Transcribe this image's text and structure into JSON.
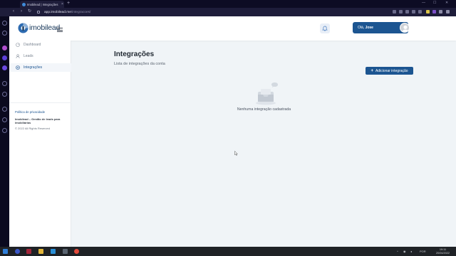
{
  "browser": {
    "tab_title": "Imobilead | Integrações",
    "tab_close": "×",
    "new_tab": "+",
    "url_host": "app.imobilead.me",
    "url_path": "/integracoes/",
    "window_controls": [
      "—",
      "☐",
      "✕"
    ],
    "nav_icons": [
      "back-icon",
      "forward-icon",
      "reload-icon"
    ]
  },
  "header": {
    "logo_text": "imobilead",
    "greeting_prefix": "Olá,",
    "user_name": "Jose",
    "icons": [
      "menu-icon",
      "bell-icon",
      "avatar"
    ]
  },
  "sidebar": {
    "items": [
      {
        "label": "Dashboard",
        "icon": "dashboard-icon",
        "active": false
      },
      {
        "label": "Leads",
        "icon": "user-icon",
        "active": false
      },
      {
        "label": "Integrações",
        "icon": "plus-circle-icon",
        "active": true
      }
    ],
    "privacy_link": "Política de privacidade",
    "footer_company": "Imobilead – Gestão de leads para imobiliárias",
    "footer_rights": "© 2022 All Rights Reserved"
  },
  "main": {
    "title": "Integrações",
    "subtitle": "Lista de integrações da conta",
    "add_button": "Adicionar integração",
    "empty_message": "Nenhuma integração cadastrada"
  },
  "taskbar": {
    "time": "19:11",
    "date": "20/04/2022",
    "language": "POR"
  },
  "colors": {
    "primary": "#1c5591",
    "page_bg": "#f0f4f7",
    "browser_chrome": "#1e1d3a"
  }
}
